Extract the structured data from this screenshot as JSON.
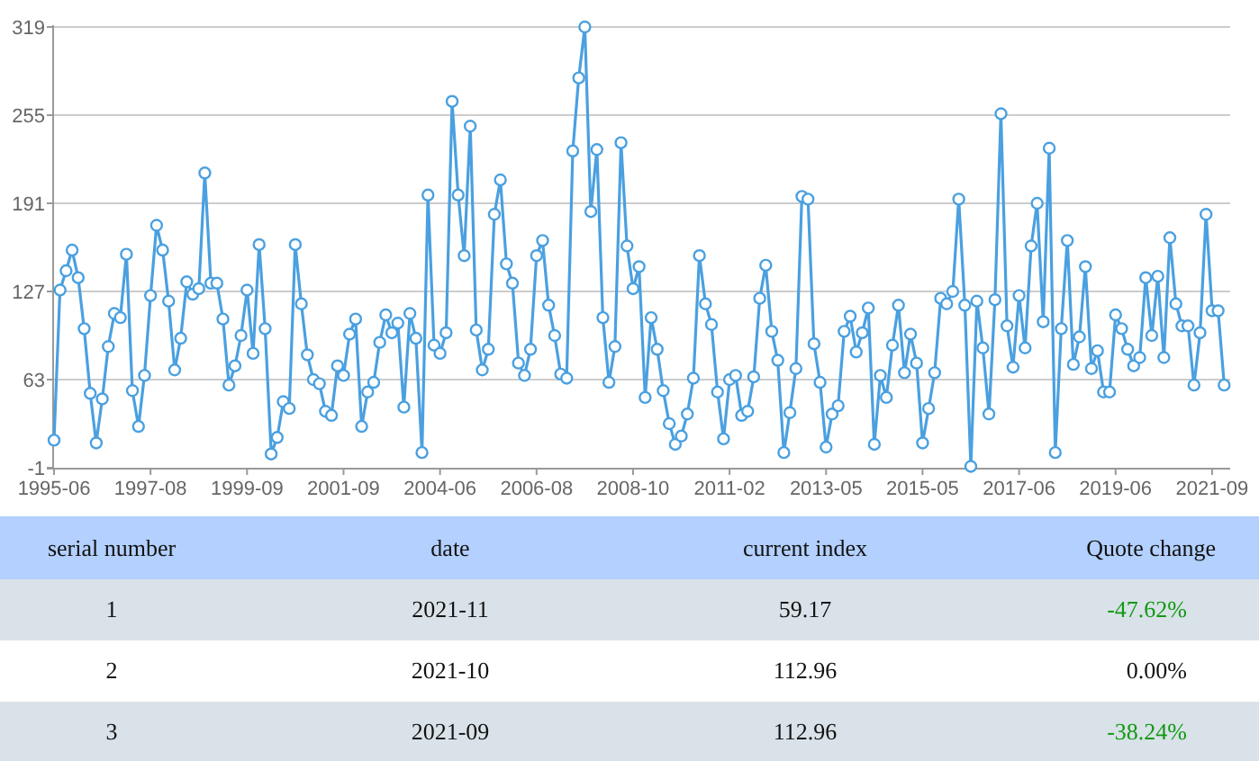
{
  "chart": {
    "chart_data": {
      "type": "line",
      "categories": [
        "1995-06",
        null,
        null,
        null,
        null,
        null,
        null,
        null,
        null,
        null,
        null,
        null,
        null,
        null,
        null,
        null,
        "1997-08",
        null,
        null,
        null,
        null,
        null,
        null,
        null,
        null,
        null,
        null,
        null,
        null,
        null,
        null,
        null,
        "1999-09",
        null,
        null,
        null,
        null,
        null,
        null,
        null,
        null,
        null,
        null,
        null,
        null,
        null,
        null,
        null,
        "2001-09",
        null,
        null,
        null,
        null,
        null,
        null,
        null,
        null,
        null,
        null,
        null,
        null,
        null,
        null,
        null,
        "2004-06",
        null,
        null,
        null,
        null,
        null,
        null,
        null,
        null,
        null,
        null,
        null,
        null,
        null,
        null,
        null,
        "2006-08",
        null,
        null,
        null,
        null,
        null,
        null,
        null,
        null,
        null,
        null,
        null,
        null,
        null,
        null,
        null,
        "2008-10",
        null,
        null,
        null,
        null,
        null,
        null,
        null,
        null,
        null,
        null,
        null,
        null,
        null,
        null,
        null,
        "2011-02",
        null,
        null,
        null,
        null,
        null,
        null,
        null,
        null,
        null,
        null,
        null,
        null,
        null,
        null,
        null,
        "2013-05",
        null,
        null,
        null,
        null,
        null,
        null,
        null,
        null,
        null,
        null,
        null,
        null,
        null,
        null,
        null,
        "2015-05",
        null,
        null,
        null,
        null,
        null,
        null,
        null,
        null,
        null,
        null,
        null,
        null,
        null,
        null,
        null,
        "2017-06",
        null,
        null,
        null,
        null,
        null,
        null,
        null,
        null,
        null,
        null,
        null,
        null,
        null,
        null,
        null,
        "2019-06",
        null,
        null,
        null,
        null,
        null,
        null,
        null,
        null,
        null,
        null,
        null,
        null,
        null,
        null,
        null,
        "2021-09",
        null,
        null
      ],
      "grid": true,
      "series": [
        {
          "color": "#4aa0e0",
          "marker": "circle",
          "values": [
            19,
            128,
            142,
            157,
            137,
            100,
            53,
            17,
            49,
            87,
            111,
            108,
            154,
            55,
            29,
            66,
            124,
            175,
            157,
            120,
            70,
            93,
            134,
            125,
            129,
            213,
            133,
            133,
            107,
            59,
            73,
            95,
            128,
            82,
            161,
            100,
            9,
            21,
            47,
            42,
            161,
            118,
            81,
            63,
            60,
            40,
            37,
            73,
            66,
            96,
            107,
            29,
            54,
            61,
            90,
            110,
            97,
            104,
            43,
            111,
            93,
            10,
            197,
            88,
            82,
            97,
            265,
            197,
            153,
            247,
            99,
            70,
            85,
            183,
            208,
            147,
            133,
            75,
            66,
            85,
            153,
            164,
            117,
            95,
            67,
            64,
            229,
            282,
            319,
            185,
            230,
            108,
            61,
            87,
            235,
            160,
            129,
            145,
            50,
            108,
            85,
            55,
            31,
            16,
            22,
            38,
            64,
            153,
            118,
            103,
            54,
            20,
            63,
            66,
            37,
            40,
            65,
            122,
            146,
            98,
            77,
            10,
            39,
            71,
            196,
            194,
            89,
            61,
            14,
            38,
            44,
            98,
            109,
            83,
            97,
            115,
            16,
            66,
            50,
            88,
            117,
            68,
            96,
            75,
            17,
            42,
            68,
            122,
            118,
            127,
            194,
            117,
            0,
            120,
            86,
            38,
            121,
            256,
            102,
            72,
            124,
            86,
            160,
            191,
            105,
            231,
            10,
            100,
            164,
            74,
            94,
            145,
            71,
            84,
            54,
            54,
            110,
            100,
            85,
            73,
            79,
            137,
            95,
            138,
            79,
            166,
            118,
            102,
            102,
            59,
            97,
            183,
            113,
            113,
            59
          ]
        }
      ],
      "ylim": [
        -1,
        319
      ],
      "yticks": [
        -1,
        63,
        127,
        191,
        255,
        319
      ]
    }
  },
  "table": {
    "columns": [
      "serial number",
      "date",
      "current index",
      "Quote change"
    ],
    "rows": [
      {
        "cells": [
          "1",
          "2021-11",
          "59.17",
          "-47.62%"
        ],
        "color": "#119911"
      },
      {
        "cells": [
          "2",
          "2021-10",
          "112.96",
          "0.00%"
        ],
        "color": "#111111"
      },
      {
        "cells": [
          "3",
          "2021-09",
          "112.96",
          "-38.24%"
        ],
        "color": "#119911"
      }
    ]
  }
}
